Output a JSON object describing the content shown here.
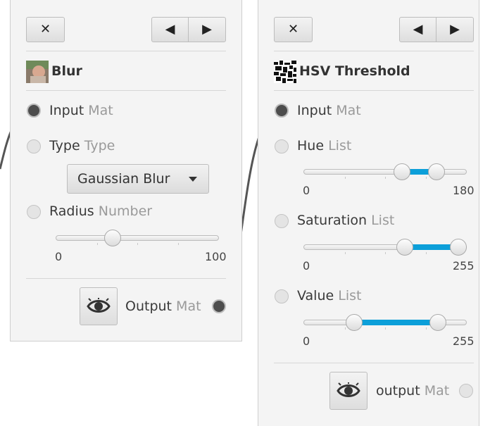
{
  "icons": {
    "close": "close-icon",
    "prev": "arrow-left-icon",
    "next": "arrow-right-icon",
    "preview": "eye-icon"
  },
  "colors": {
    "accent": "#0c9fd9",
    "wire": "#555555"
  },
  "blur": {
    "close_label": "✕",
    "prev_label": "◀",
    "next_label": "▶",
    "title": "Blur",
    "input": {
      "name": "Input",
      "type": "Mat"
    },
    "type_param": {
      "name": "Type",
      "type": "Type",
      "value": "Gaussian Blur"
    },
    "radius": {
      "name": "Radius",
      "type": "Number",
      "min": "0",
      "max": "100",
      "value": 33
    },
    "output": {
      "name": "Output",
      "type": "Mat"
    }
  },
  "hsv": {
    "close_label": "✕",
    "prev_label": "◀",
    "next_label": "▶",
    "title": "HSV Threshold",
    "input": {
      "name": "Input",
      "type": "Mat"
    },
    "hue": {
      "name": "Hue",
      "type": "List",
      "min": "0",
      "max": "180",
      "low": 111,
      "high": 153
    },
    "saturation": {
      "name": "Saturation",
      "type": "List",
      "min": "0",
      "max": "255",
      "low": 162,
      "high": 255
    },
    "value": {
      "name": "Value",
      "type": "List",
      "min": "0",
      "max": "255",
      "low": 74,
      "high": 220
    },
    "output": {
      "name": "output",
      "type": "Mat"
    }
  }
}
